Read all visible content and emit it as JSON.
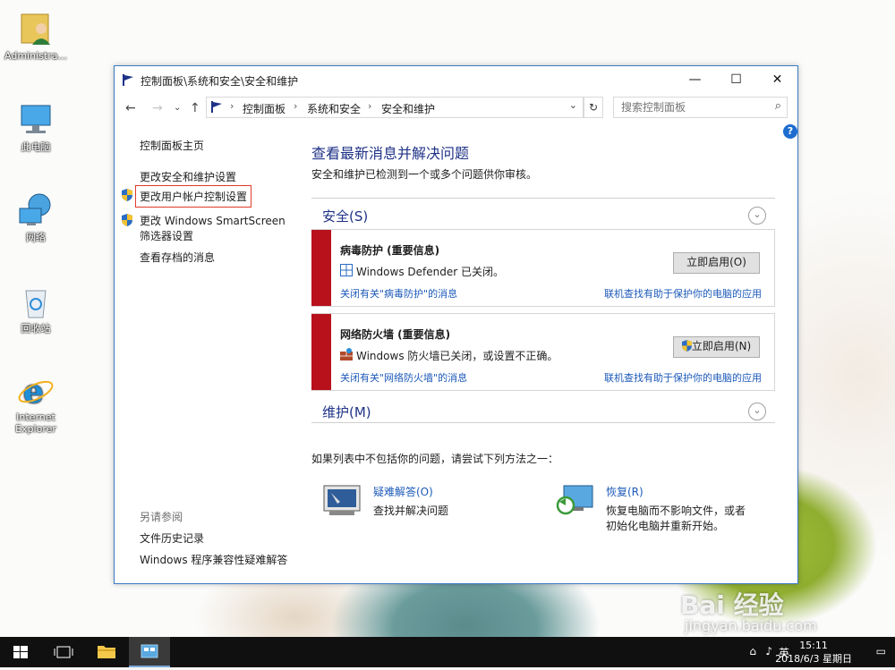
{
  "desktop": {
    "icons": [
      {
        "label": "Administra..."
      },
      {
        "label": "此电脑"
      },
      {
        "label": "网络"
      },
      {
        "label": "回收站"
      },
      {
        "label_line1": "Internet",
        "label_line2": "Explorer"
      }
    ]
  },
  "window": {
    "title": "控制面板\\系统和安全\\安全和维护",
    "controls": {
      "minimize": "—",
      "maximize": "☐",
      "close": "✕"
    },
    "address": {
      "segments": [
        "控制面板",
        "系统和安全",
        "安全和维护"
      ],
      "separator": "›"
    },
    "search": {
      "placeholder": "搜索控制面板"
    },
    "help": "?"
  },
  "left_pane": {
    "home": "控制面板主页",
    "links": [
      "更改安全和维护设置",
      "更改用户帐户控制设置",
      "更改 Windows SmartScreen",
      "筛选器设置",
      "查看存档的消息"
    ],
    "see_also_title": "另请参阅",
    "see_also": [
      "文件历史记录",
      "Windows 程序兼容性疑难解答"
    ]
  },
  "main": {
    "title": "查看最新消息并解决问题",
    "subtitle": "安全和维护已检测到一个或多个问题供你审核。",
    "security": {
      "title": "安全(S)",
      "messages": [
        {
          "title": "病毒防护  (重要信息)",
          "desc": "Windows Defender 已关闭。",
          "button": "立即启用(O)",
          "link_left": "关闭有关\"病毒防护\"的消息",
          "link_right": "联机查找有助于保护你的电脑的应用"
        },
        {
          "title": "网络防火墙  (重要信息)",
          "desc": "Windows 防火墙已关闭，或设置不正确。",
          "button": "立即启用(N)",
          "link_left": "关闭有关\"网络防火墙\"的消息",
          "link_right": "联机查找有助于保护你的电脑的应用"
        }
      ]
    },
    "maintenance": {
      "title": "维护(M)"
    },
    "hint": "如果列表中不包括你的问题，请尝试下列方法之一：",
    "tools": [
      {
        "name": "疑难解答(O)",
        "desc": "查找并解决问题"
      },
      {
        "name": "恢复(R)",
        "desc_line1": "恢复电脑而不影响文件，或者",
        "desc_line2": "初始化电脑并重新开始。"
      }
    ]
  },
  "taskbar": {
    "ime": "英",
    "time": "15:11",
    "date": "2018/6/3 星期日"
  },
  "watermark": {
    "line1": "Bai 经验",
    "line2": "jingyan.baidu.com"
  },
  "colors": {
    "accent_blue": "#1e3287",
    "link_blue": "#1d5ab9",
    "alert_red": "#b8111c",
    "annotation_red": "#e03a2a"
  }
}
